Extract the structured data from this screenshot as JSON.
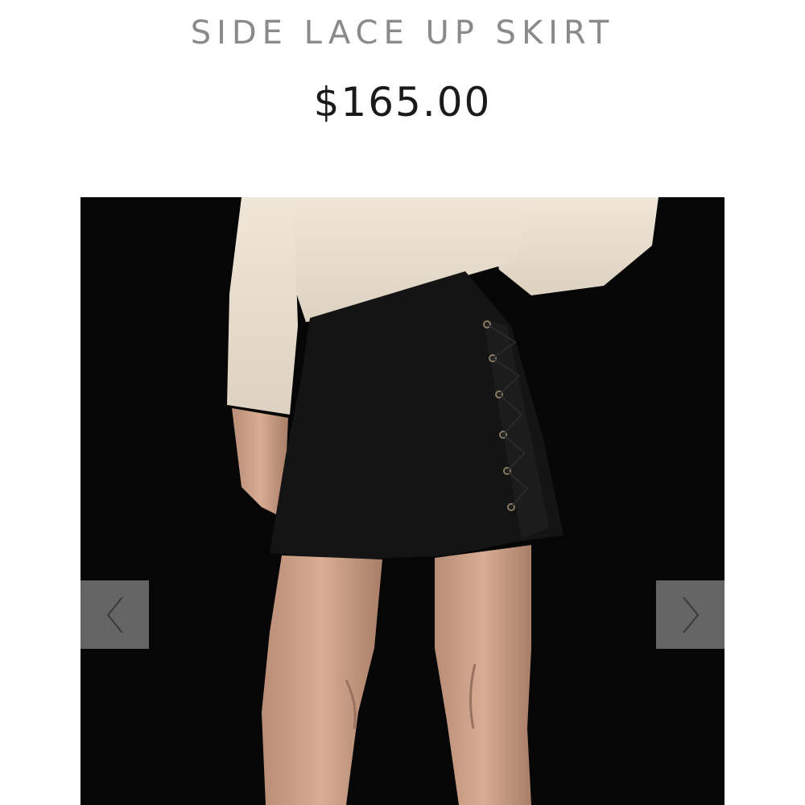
{
  "product": {
    "title": "SIDE LACE UP SKIRT",
    "price": "$165.00"
  },
  "gallery": {
    "prev_icon": "chevron-left-icon",
    "next_icon": "chevron-right-icon"
  },
  "colors": {
    "title_color": "#8a8a8a",
    "price_color": "#1a1a1a",
    "gallery_background": "#060606",
    "nav_button": "#6e6e6e"
  }
}
